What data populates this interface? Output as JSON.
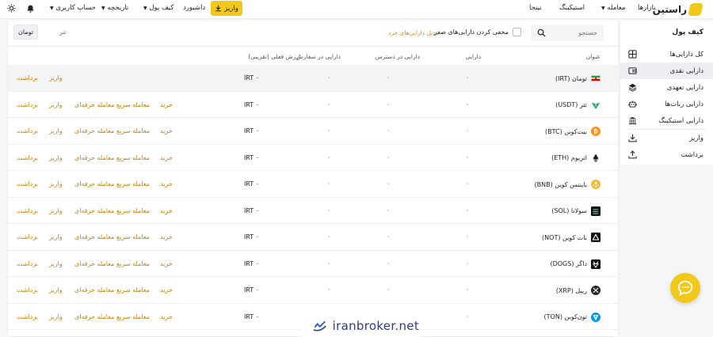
{
  "header": {
    "brand": "راستین",
    "nav": {
      "markets": "بازارها",
      "trade": "معامله",
      "staking": "استیکینگ",
      "ninja": "نینجا",
      "deposit": "واریز",
      "dashboard": "داشبورد",
      "wallet": "کیف پول",
      "history": "تاریخچه",
      "account": "حساب کاربری"
    }
  },
  "sidebar": {
    "title": "کیف پول",
    "items": [
      {
        "label": "کل دارایی‌ها",
        "icon": "grid-icon"
      },
      {
        "label": "دارایی نقدی",
        "icon": "wallet-icon",
        "active": true
      },
      {
        "label": "دارایی تعهدی",
        "icon": "layers-icon"
      },
      {
        "label": "دارایی ربات‌ها",
        "icon": "robot-icon"
      },
      {
        "label": "دارایی استیکینگ",
        "icon": "bank-icon"
      }
    ],
    "actions": [
      {
        "label": "واریز",
        "icon": "download-icon"
      },
      {
        "label": "برداشت",
        "icon": "upload-icon"
      }
    ]
  },
  "toolbar": {
    "search_placeholder": "جستجو",
    "hide_zero_label": "مخفی کردن دارایی‌های صفر",
    "convert_small_link": "تبدیل دارایی‌های خرد",
    "tabs": [
      "تومان",
      "تتر"
    ]
  },
  "table": {
    "headers": {
      "name": "عنوان",
      "balance": "دارایی",
      "available": "دارایی در دسترس",
      "in_order": "دارایی در سفارش",
      "value": "ارزش فعلی (تقریبی)"
    },
    "actions": {
      "buy": "خرید",
      "quick": "معامله سریع",
      "pro": "معامله حرفه‌ای",
      "deposit": "واریز",
      "withdraw": "برداشت"
    },
    "rows": [
      {
        "name": "تومان (IRT)",
        "balance": "۰",
        "available": "۰",
        "in_order": "۰",
        "value": "IRT ۰",
        "icon_color": "#ffffff",
        "trade": false
      },
      {
        "name": "تتر (USDT)",
        "balance": "۰",
        "available": "۰",
        "in_order": "۰",
        "value": "IRT ۰",
        "icon_color": "#26a17b",
        "trade": true
      },
      {
        "name": "بیت‌کوین (BTC)",
        "balance": "۰",
        "available": "۰",
        "in_order": "۰",
        "value": "IRT ۰",
        "icon_color": "#f7931a",
        "trade": true
      },
      {
        "name": "اتریوم (ETH)",
        "balance": "۰",
        "available": "۰",
        "in_order": "۰",
        "value": "IRT ۰",
        "icon_color": "#ffffff",
        "trade": true
      },
      {
        "name": "بایننس کوین (BNB)",
        "balance": "۰",
        "available": "۰",
        "in_order": "۰",
        "value": "IRT ۰",
        "icon_color": "#f3ba2f",
        "trade": true
      },
      {
        "name": "سولانا (SOL)",
        "balance": "۰",
        "available": "۰",
        "in_order": "۰",
        "value": "IRT ۰",
        "icon_color": "#111111",
        "trade": true
      },
      {
        "name": "نات کوین (NOT)",
        "balance": "۰",
        "available": "۰",
        "in_order": "۰",
        "value": "IRT ۰",
        "icon_color": "#111111",
        "trade": true
      },
      {
        "name": "داگز (DOGS)",
        "balance": "۰",
        "available": "۰",
        "in_order": "۰",
        "value": "IRT ۰",
        "icon_color": "#111111",
        "trade": true
      },
      {
        "name": "ریپل (XRP)",
        "balance": "۰",
        "available": "۰",
        "in_order": "۰",
        "value": "IRT ۰",
        "icon_color": "#23292f",
        "trade": true
      },
      {
        "name": "تون‌کوین (TON)",
        "balance": "۰",
        "available": "۰",
        "in_order": "۰",
        "value": "IRT ۰",
        "icon_color": "#0098ea",
        "trade": true
      }
    ]
  },
  "watermark": "iranbroker.net",
  "colors": {
    "accent": "#f2c81a",
    "link": "#c8830a"
  }
}
